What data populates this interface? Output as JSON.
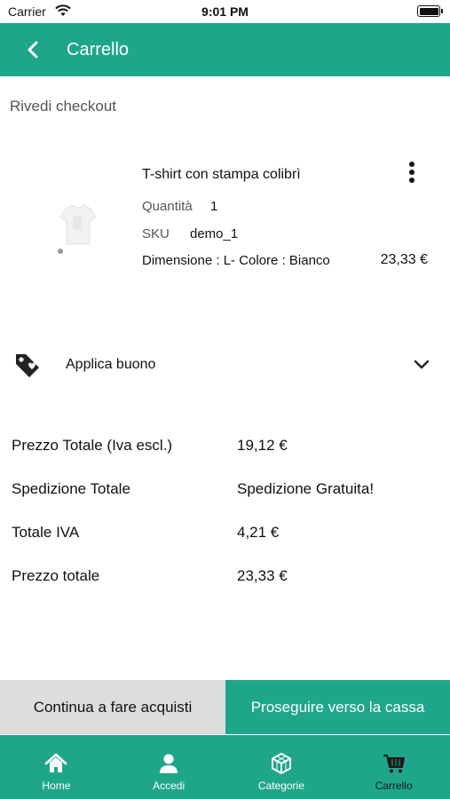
{
  "status_bar": {
    "carrier": "Carrier",
    "time": "9:01 PM"
  },
  "header": {
    "title": "Carrello"
  },
  "section_title": "Rivedi checkout",
  "cart_item": {
    "name": "T-shirt con stampa colibrì",
    "quantity_label": "Quantità",
    "quantity_value": "1",
    "sku_label": "SKU",
    "sku_value": "demo_1",
    "variant": "Dimensione : L- Colore : Bianco",
    "price": "23,33 €"
  },
  "coupon": {
    "label": "Applica buono"
  },
  "summary": [
    {
      "label": "Prezzo Totale (Iva escl.)",
      "value": "19,12 €"
    },
    {
      "label": "Spedizione Totale",
      "value": "Spedizione Gratuita!"
    },
    {
      "label": "Totale IVA",
      "value": "4,21 €"
    },
    {
      "label": "Prezzo totale",
      "value": "23,33 €"
    }
  ],
  "actions": {
    "continue_label": "Continua a fare acquisti",
    "checkout_label": "Proseguire verso la cassa"
  },
  "tabs": [
    {
      "label": "Home",
      "icon": "home-icon"
    },
    {
      "label": "Accedi",
      "icon": "user-icon"
    },
    {
      "label": "Categorie",
      "icon": "cube-icon"
    },
    {
      "label": "Carrello",
      "icon": "cart-icon",
      "active": true
    }
  ],
  "colors": {
    "primary": "#1fa68a",
    "secondary_button": "#dddddd",
    "active_tab_label": "#1a1a1a"
  }
}
